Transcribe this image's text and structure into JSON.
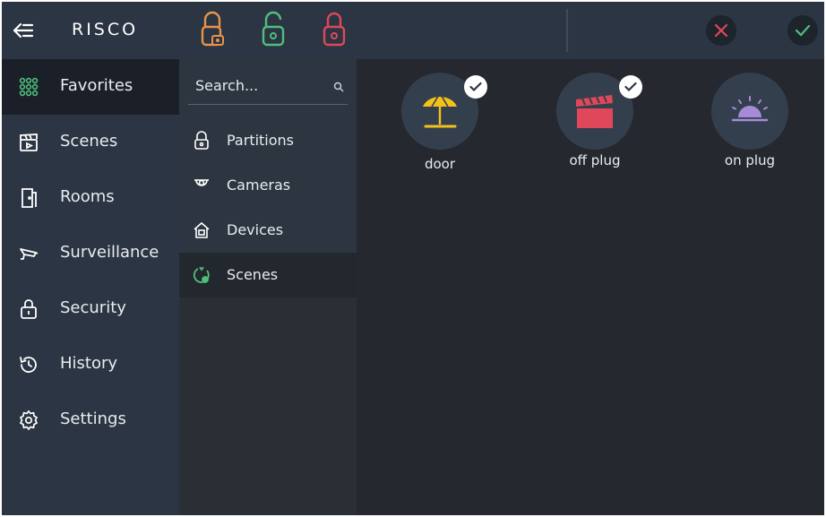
{
  "header": {
    "logo": "RISCO",
    "back_icon": "back-arrow-icon",
    "locks": [
      {
        "icon": "partial-lock-icon",
        "color": "#e8924a"
      },
      {
        "icon": "unlock-icon",
        "color": "#4fbf7a"
      },
      {
        "icon": "lock-icon",
        "color": "#e0475a"
      }
    ],
    "cancel_icon": "close-icon",
    "confirm_icon": "check-icon",
    "cancel_color": "#e0475a",
    "confirm_color": "#4fbf7a"
  },
  "sidebar": {
    "items": [
      {
        "label": "Favorites",
        "icon": "grid-icon",
        "active": true
      },
      {
        "label": "Scenes",
        "icon": "clapperboard-icon"
      },
      {
        "label": "Rooms",
        "icon": "door-icon"
      },
      {
        "label": "Surveillance",
        "icon": "camera-icon"
      },
      {
        "label": "Security",
        "icon": "padlock-icon"
      },
      {
        "label": "History",
        "icon": "history-icon"
      },
      {
        "label": "Settings",
        "icon": "gear-icon"
      }
    ]
  },
  "subpanel": {
    "search_placeholder": "Search...",
    "items": [
      {
        "label": "Partitions",
        "icon": "partition-lock-icon"
      },
      {
        "label": "Cameras",
        "icon": "dome-camera-icon"
      },
      {
        "label": "Devices",
        "icon": "house-icon"
      },
      {
        "label": "Scenes",
        "icon": "scene-icon",
        "active": true
      }
    ]
  },
  "content": {
    "tiles": [
      {
        "label": "door",
        "icon": "beach-umbrella-icon",
        "checked": true,
        "color": "#f2c21b"
      },
      {
        "label": "off plug",
        "icon": "clapperboard-icon",
        "checked": true,
        "color": "#e0475a"
      },
      {
        "label": "on plug",
        "icon": "sunrise-icon",
        "checked": false,
        "color": "#a68bd8"
      }
    ]
  }
}
